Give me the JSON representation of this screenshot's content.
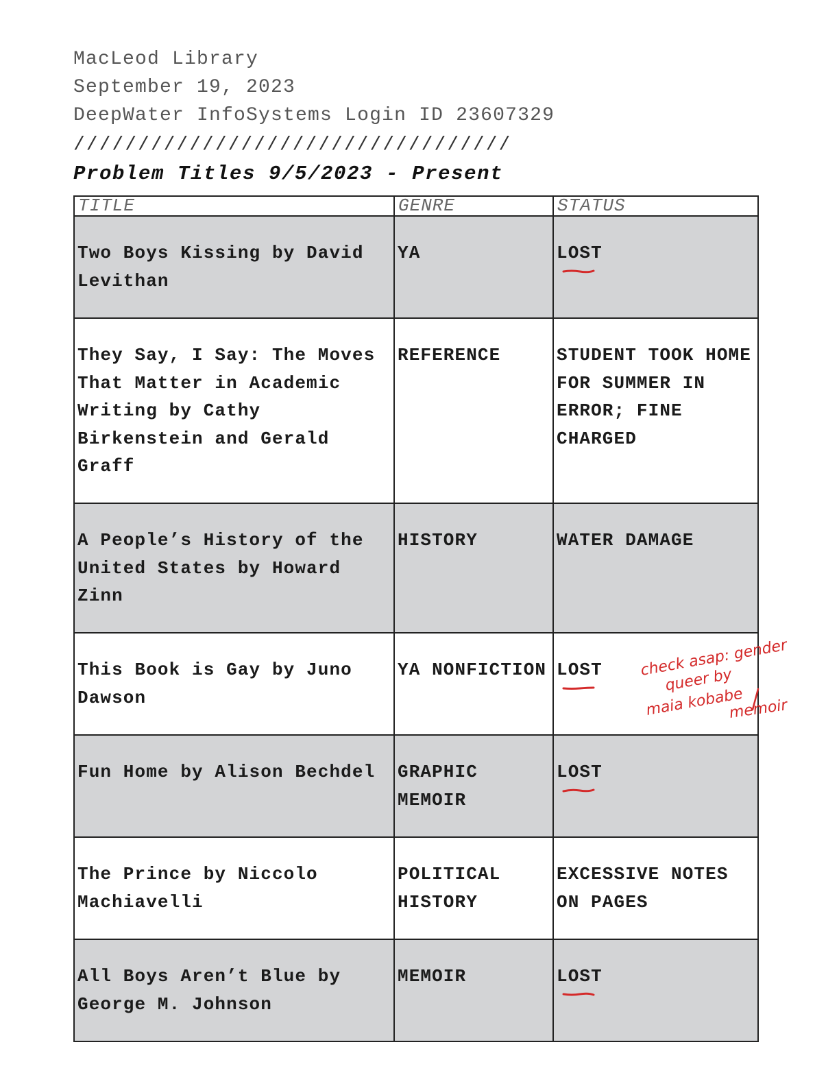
{
  "header": {
    "library": "MacLeod Library",
    "date": "September 19, 2023",
    "login": "DeepWater InfoSystems Login ID 23607329",
    "divider": "//////////////////////////////////",
    "title": "Problem Titles 9/5/2023 - Present"
  },
  "table": {
    "columns": [
      "TITLE",
      "GENRE",
      "STATUS"
    ],
    "rows": [
      {
        "title": "Two Boys Kissing by David Levithan",
        "genre": "YA",
        "status": "LOST"
      },
      {
        "title": "They Say, I Say: The Moves That Matter in Academic Writing by Cathy Birkenstein and Gerald Graff",
        "genre": "REFERENCE",
        "status": "STUDENT TOOK HOME FOR SUMMER IN ERROR; FINE CHARGED"
      },
      {
        "title": "A People’s History of the United States by Howard Zinn",
        "genre": "HISTORY",
        "status": "WATER DAMAGE"
      },
      {
        "title": "This Book is Gay by Juno Dawson",
        "genre": "YA NONFICTION",
        "status": "LOST"
      },
      {
        "title": "Fun Home by Alison Bechdel",
        "genre": "GRAPHIC MEMOIR",
        "status": "LOST"
      },
      {
        "title": "The Prince by Niccolo Machiavelli",
        "genre": "POLITICAL HISTORY",
        "status": "EXCESSIVE NOTES ON PAGES"
      },
      {
        "title": "All Boys Aren’t Blue by George M. Johnson",
        "genre": "MEMOIR",
        "status": "LOST"
      }
    ]
  },
  "annotation": {
    "handwritten_note": "check asap: gender queer by maia kobabe / memoir",
    "color": "#d42a2a"
  }
}
